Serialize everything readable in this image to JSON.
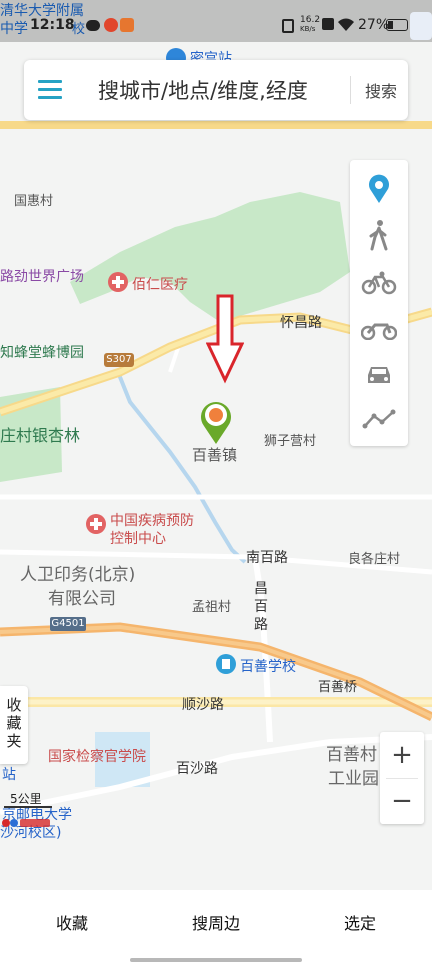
{
  "status_bar": {
    "time": "12:18",
    "overlay_text_line1": "清华大学附属",
    "overlay_text_line2": "中学",
    "overlay_suffix": "校",
    "net_speed_top": "16.2",
    "net_speed_unit": "KB/s",
    "battery": "27%"
  },
  "search": {
    "placeholder": "搜城市/地点/维度,经度",
    "button": "搜索"
  },
  "top_poi": "密宫站",
  "map_labels": {
    "guohui": "国惠村",
    "lujin": "路劲世界广场",
    "bairen": "佰仁医疗",
    "huaichang": "怀昌路",
    "zhifeng": "知蜂堂蜂博园",
    "s307": "S307",
    "zhuangcun": "庄村银杏林",
    "baishan_town": "百善镇",
    "shizi": "狮子营村",
    "cdc_line1": "中国疾病预防",
    "cdc_line2": "控制中心",
    "nanbai": "南百路",
    "liangge": "良各庄村",
    "renwei_line1": "人卫印务(北京)",
    "renwei_line2": "有限公司",
    "g4501": "G4501",
    "changbai_1": "昌",
    "changbai_2": "百",
    "changbai_3": "路",
    "mengzu": "孟祖村",
    "baishan_school": "百善学校",
    "baishan_bridge": "百善桥",
    "shunsha": "顺沙路",
    "procurator": "国家检察官学院",
    "baishan_park_line1": "百善村",
    "baishan_park_line2": "工业园",
    "baisha": "百沙路",
    "zhan": "站",
    "bupt_line1": "京邮电大学",
    "bupt_line2": "沙河校区)",
    "scale": "5公里"
  },
  "favorites_side": "收藏夹",
  "zoom": {
    "in": "+",
    "out": "−"
  },
  "bottom_bar": {
    "favorites": "收藏",
    "nearby": "搜周边",
    "select": "选定"
  },
  "colors": {
    "accent": "#25a2c4",
    "location_pin": "#2f9fd8",
    "marker_green": "#6aa92a",
    "marker_orange": "#f0803c",
    "arrow_red": "#d9252b",
    "park_green": "#c8e8c8",
    "expressway": "#f5b56c"
  }
}
